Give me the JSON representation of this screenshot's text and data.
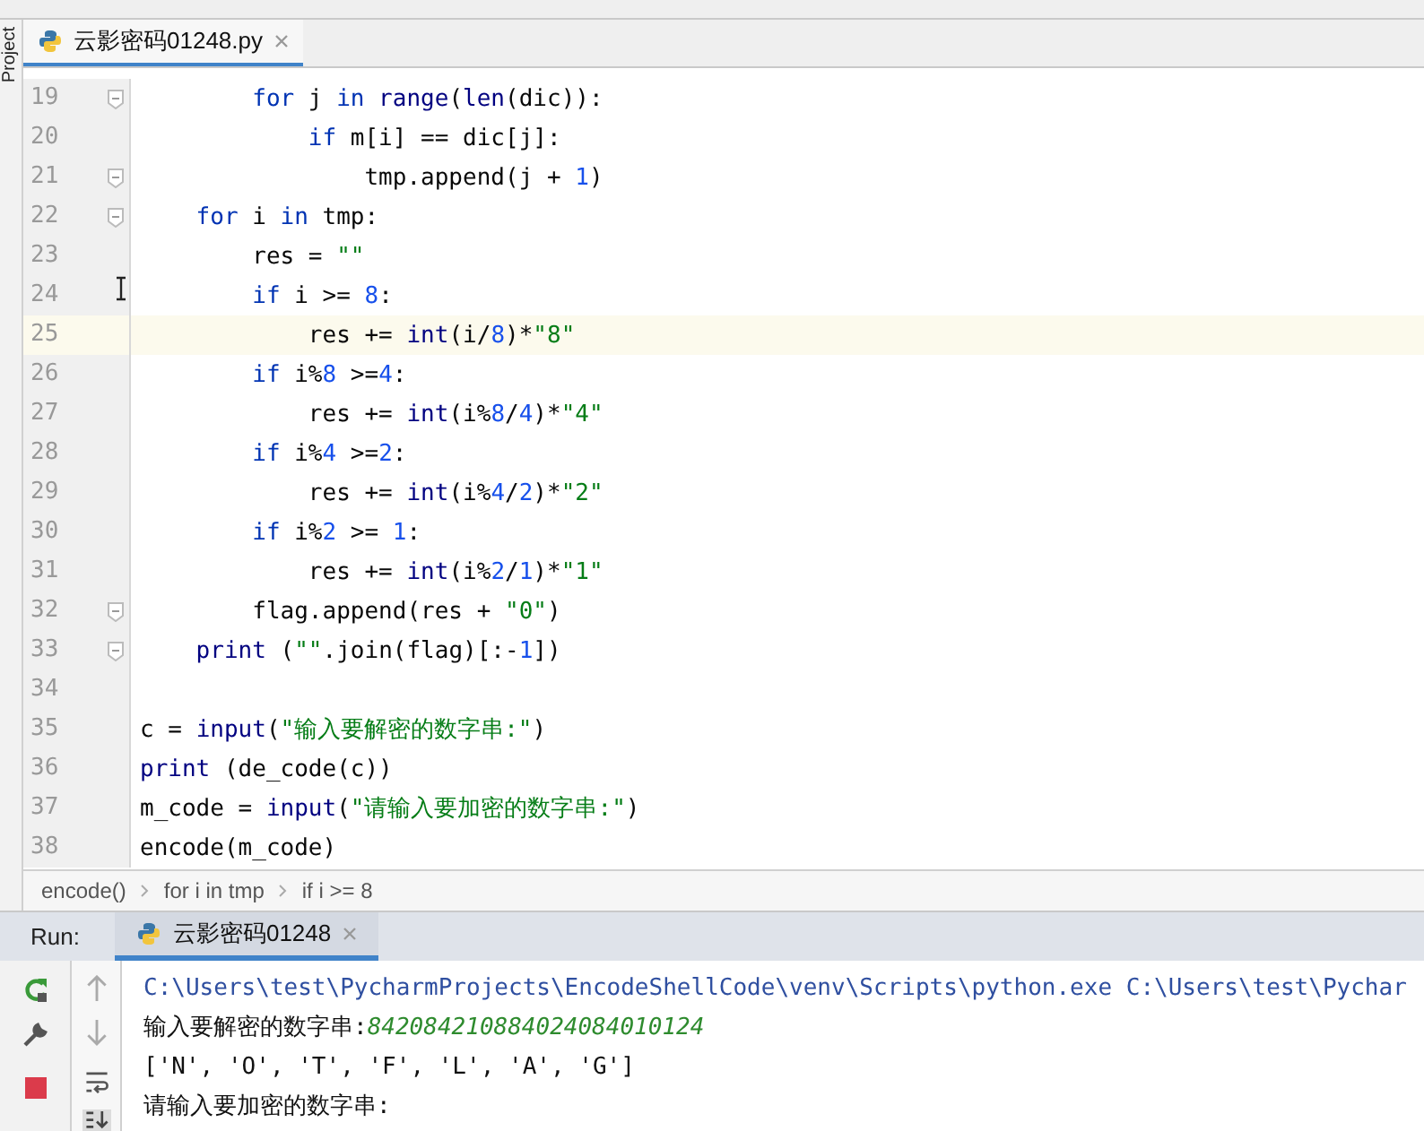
{
  "side_tool_window": {
    "label": "Project"
  },
  "editor_tabs": [
    {
      "label": "云影密码01248.py",
      "selected": true
    }
  ],
  "code_lines": [
    {
      "number": "19",
      "fold_marker": true,
      "current": false,
      "tokens": [
        {
          "text": "        for",
          "kind": "keyword"
        },
        {
          "text": " j ",
          "kind": "plain"
        },
        {
          "text": "in",
          "kind": "keyword"
        },
        {
          "text": " range",
          "kind": "builtin"
        },
        {
          "text": "(",
          "kind": "plain"
        },
        {
          "text": "len",
          "kind": "builtin"
        },
        {
          "text": "(dic)):",
          "kind": "plain"
        }
      ]
    },
    {
      "number": "20",
      "fold_marker": false,
      "current": false,
      "tokens": [
        {
          "text": "            if",
          "kind": "keyword"
        },
        {
          "text": " m[i] == dic[j]:",
          "kind": "plain"
        }
      ]
    },
    {
      "number": "21",
      "fold_marker": true,
      "current": false,
      "tokens": [
        {
          "text": "                tmp.append(j + ",
          "kind": "plain"
        },
        {
          "text": "1",
          "kind": "number"
        },
        {
          "text": ")",
          "kind": "plain"
        }
      ]
    },
    {
      "number": "22",
      "fold_marker": true,
      "current": false,
      "tokens": [
        {
          "text": "    for",
          "kind": "keyword"
        },
        {
          "text": " i ",
          "kind": "plain"
        },
        {
          "text": "in",
          "kind": "keyword"
        },
        {
          "text": " tmp:",
          "kind": "plain"
        }
      ]
    },
    {
      "number": "23",
      "fold_marker": false,
      "current": false,
      "tokens": [
        {
          "text": "        res = ",
          "kind": "plain"
        },
        {
          "text": "\"\"",
          "kind": "string"
        }
      ]
    },
    {
      "number": "24",
      "fold_marker": false,
      "current": false,
      "tokens": [
        {
          "text": "        if",
          "kind": "keyword"
        },
        {
          "text": " i >= ",
          "kind": "plain"
        },
        {
          "text": "8",
          "kind": "number"
        },
        {
          "text": ":",
          "kind": "plain"
        }
      ]
    },
    {
      "number": "25",
      "fold_marker": false,
      "current": true,
      "tokens": [
        {
          "text": "            res += ",
          "kind": "plain"
        },
        {
          "text": "int",
          "kind": "builtin"
        },
        {
          "text": "(i/",
          "kind": "plain"
        },
        {
          "text": "8",
          "kind": "number"
        },
        {
          "text": ")*",
          "kind": "plain"
        },
        {
          "text": "\"8\"",
          "kind": "string"
        }
      ]
    },
    {
      "number": "26",
      "fold_marker": false,
      "current": false,
      "tokens": [
        {
          "text": "        if",
          "kind": "keyword"
        },
        {
          "text": " i%",
          "kind": "plain"
        },
        {
          "text": "8",
          "kind": "number"
        },
        {
          "text": " >=",
          "kind": "plain"
        },
        {
          "text": "4",
          "kind": "number"
        },
        {
          "text": ":",
          "kind": "plain"
        }
      ]
    },
    {
      "number": "27",
      "fold_marker": false,
      "current": false,
      "tokens": [
        {
          "text": "            res += ",
          "kind": "plain"
        },
        {
          "text": "int",
          "kind": "builtin"
        },
        {
          "text": "(i%",
          "kind": "plain"
        },
        {
          "text": "8",
          "kind": "number"
        },
        {
          "text": "/",
          "kind": "plain"
        },
        {
          "text": "4",
          "kind": "number"
        },
        {
          "text": ")*",
          "kind": "plain"
        },
        {
          "text": "\"4\"",
          "kind": "string"
        }
      ]
    },
    {
      "number": "28",
      "fold_marker": false,
      "current": false,
      "tokens": [
        {
          "text": "        if",
          "kind": "keyword"
        },
        {
          "text": " i%",
          "kind": "plain"
        },
        {
          "text": "4",
          "kind": "number"
        },
        {
          "text": " >=",
          "kind": "plain"
        },
        {
          "text": "2",
          "kind": "number"
        },
        {
          "text": ":",
          "kind": "plain"
        }
      ]
    },
    {
      "number": "29",
      "fold_marker": false,
      "current": false,
      "tokens": [
        {
          "text": "            res += ",
          "kind": "plain"
        },
        {
          "text": "int",
          "kind": "builtin"
        },
        {
          "text": "(i%",
          "kind": "plain"
        },
        {
          "text": "4",
          "kind": "number"
        },
        {
          "text": "/",
          "kind": "plain"
        },
        {
          "text": "2",
          "kind": "number"
        },
        {
          "text": ")*",
          "kind": "plain"
        },
        {
          "text": "\"2\"",
          "kind": "string"
        }
      ]
    },
    {
      "number": "30",
      "fold_marker": false,
      "current": false,
      "tokens": [
        {
          "text": "        if",
          "kind": "keyword"
        },
        {
          "text": " i%",
          "kind": "plain"
        },
        {
          "text": "2",
          "kind": "number"
        },
        {
          "text": " >= ",
          "kind": "plain"
        },
        {
          "text": "1",
          "kind": "number"
        },
        {
          "text": ":",
          "kind": "plain"
        }
      ]
    },
    {
      "number": "31",
      "fold_marker": false,
      "current": false,
      "tokens": [
        {
          "text": "            res += ",
          "kind": "plain"
        },
        {
          "text": "int",
          "kind": "builtin"
        },
        {
          "text": "(i%",
          "kind": "plain"
        },
        {
          "text": "2",
          "kind": "number"
        },
        {
          "text": "/",
          "kind": "plain"
        },
        {
          "text": "1",
          "kind": "number"
        },
        {
          "text": ")*",
          "kind": "plain"
        },
        {
          "text": "\"1\"",
          "kind": "string"
        }
      ]
    },
    {
      "number": "32",
      "fold_marker": true,
      "current": false,
      "tokens": [
        {
          "text": "        flag.append(res + ",
          "kind": "plain"
        },
        {
          "text": "\"0\"",
          "kind": "string"
        },
        {
          "text": ")",
          "kind": "plain"
        }
      ]
    },
    {
      "number": "33",
      "fold_marker": true,
      "current": false,
      "tokens": [
        {
          "text": "    print",
          "kind": "builtin"
        },
        {
          "text": " (",
          "kind": "plain"
        },
        {
          "text": "\"\"",
          "kind": "string"
        },
        {
          "text": ".join(flag)[:-",
          "kind": "plain"
        },
        {
          "text": "1",
          "kind": "number"
        },
        {
          "text": "])",
          "kind": "plain"
        }
      ]
    },
    {
      "number": "34",
      "fold_marker": false,
      "current": false
    },
    {
      "number": "35",
      "fold_marker": false,
      "current": false,
      "tokens": [
        {
          "text": "c = ",
          "kind": "plain"
        },
        {
          "text": "input",
          "kind": "builtin"
        },
        {
          "text": "(",
          "kind": "plain"
        },
        {
          "text": "\"输入要解密的数字串:\"",
          "kind": "string"
        },
        {
          "text": ")",
          "kind": "plain"
        }
      ]
    },
    {
      "number": "36",
      "fold_marker": false,
      "current": false,
      "tokens": [
        {
          "text": "print",
          "kind": "builtin"
        },
        {
          "text": " (de_code(c))",
          "kind": "plain"
        }
      ]
    },
    {
      "number": "37",
      "fold_marker": false,
      "current": false,
      "tokens": [
        {
          "text": "m_code = ",
          "kind": "plain"
        },
        {
          "text": "input",
          "kind": "builtin"
        },
        {
          "text": "(",
          "kind": "plain"
        },
        {
          "text": "\"请输入要加密的数字串:\"",
          "kind": "string"
        },
        {
          "text": ")",
          "kind": "plain"
        }
      ]
    },
    {
      "number": "38",
      "fold_marker": false,
      "current": false,
      "tokens": [
        {
          "text": "encode(m_code)",
          "kind": "plain"
        }
      ]
    }
  ],
  "breadcrumbs": [
    "encode()",
    "for i in tmp",
    "if i >= 8"
  ],
  "run_panel": {
    "label": "Run:",
    "tabs": [
      {
        "label": "云影密码01248",
        "selected": true
      }
    ]
  },
  "console_lines": [
    {
      "kind": "command",
      "text": "C:\\Users\\test\\PycharmProjects\\EncodeShellCode\\venv\\Scripts\\python.exe C:\\Users\\test\\Pychar"
    },
    {
      "kind": "prompt",
      "text": "输入要解密的数字串:",
      "input": "842084210884024084010124"
    },
    {
      "kind": "output",
      "text": "['N', 'O', 'T', 'F', 'L', 'A', 'G']"
    },
    {
      "kind": "output",
      "text": "请输入要加密的数字串:"
    }
  ]
}
